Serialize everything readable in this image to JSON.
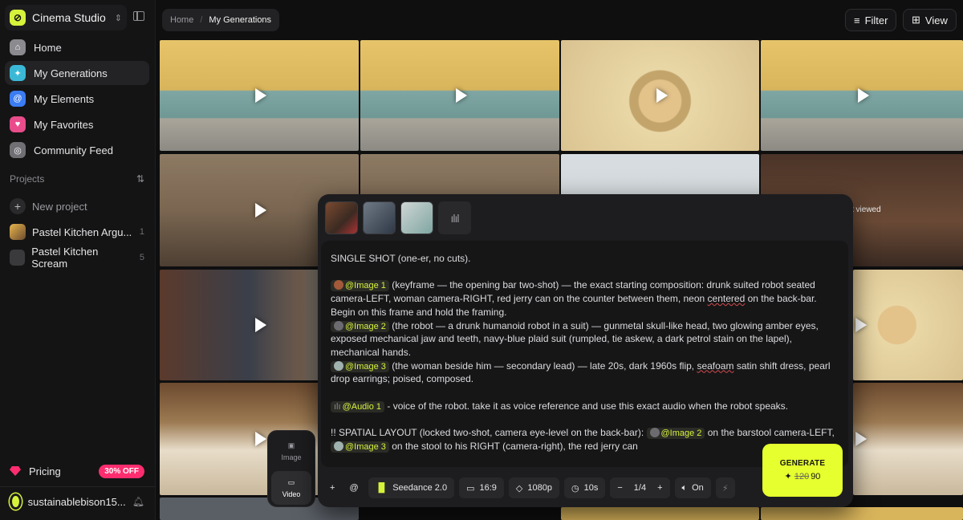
{
  "sidebar": {
    "brand": "Cinema Studio",
    "nav": [
      {
        "label": "Home",
        "color": "#8a8a8f"
      },
      {
        "label": "My Generations",
        "color": "#3bb8d6"
      },
      {
        "label": "My Elements",
        "color": "#3b7cf2"
      },
      {
        "label": "My Favorites",
        "color": "#e84c8a"
      },
      {
        "label": "Community Feed",
        "color": "#6f6f74"
      }
    ],
    "projects_label": "Projects",
    "new_project": "New project",
    "projects": [
      {
        "name": "Pastel Kitchen Argu...",
        "count": "1"
      },
      {
        "name": "Pastel Kitchen Scream",
        "count": "5"
      }
    ],
    "pricing": "Pricing",
    "pricing_badge": "30% OFF",
    "username": "sustainablebison15..."
  },
  "header": {
    "crumb_home": "Home",
    "crumb_sep": "/",
    "crumb_current": "My Generations",
    "filter": "Filter",
    "view": "View"
  },
  "grid": {
    "last_viewed": "st viewed"
  },
  "composer": {
    "prompt": {
      "p1": "SINGLE SHOT (one-er, no cuts).",
      "img1_tag": "@Image 1",
      "img1_text_a": " (keyframe — the opening bar two-shot) — the exact starting composition: drunk suited robot seated camera-LEFT, woman camera-RIGHT, red jerry can on the counter between them, neon ",
      "img1_text_u": "centered",
      "img1_text_b": " on the back-bar. Begin on this frame and hold the framing.",
      "img2_tag": "@Image 2",
      "img2_text": " (the robot — a drunk humanoid robot in a suit) — gunmetal skull-like head, two glowing amber eyes, exposed mechanical jaw and teeth, navy-blue plaid suit (rumpled, tie askew, a dark petrol stain on the lapel), mechanical hands.",
      "img3_tag": "@Image 3",
      "img3_text_a": " (the woman beside him — secondary lead) — late 20s, dark 1960s flip, ",
      "img3_text_u": "seafoam",
      "img3_text_b": " satin shift dress, pearl drop earrings; poised, composed.",
      "audio_tag": "@Audio 1",
      "audio_text": " - voice of the robot. take it as voice reference and use this exact audio when the robot speaks.",
      "layout_a": "!! SPATIAL LAYOUT (locked two-shot, camera eye-level on the back-bar): ",
      "layout_tag2": "@Image 2",
      "layout_b": " on the barstool camera-LEFT, ",
      "layout_tag3": "@Image 3",
      "layout_c": " on the stool to his RIGHT (camera-right), the red jerry can"
    },
    "toolbar": {
      "plus": "+",
      "at": "@",
      "model": "Seedance 2.0",
      "ratio": "16:9",
      "quality": "1080p",
      "duration": "10s",
      "count": "1/4",
      "minus": "−",
      "inc": "+",
      "audio": "On"
    },
    "generate": {
      "label": "GENERATE",
      "old_cost": "120",
      "cost": "90"
    }
  },
  "mode": {
    "image": "Image",
    "video": "Video"
  },
  "colors": {
    "accent": "#e6ff2e",
    "pink": "#ff2d6f"
  }
}
